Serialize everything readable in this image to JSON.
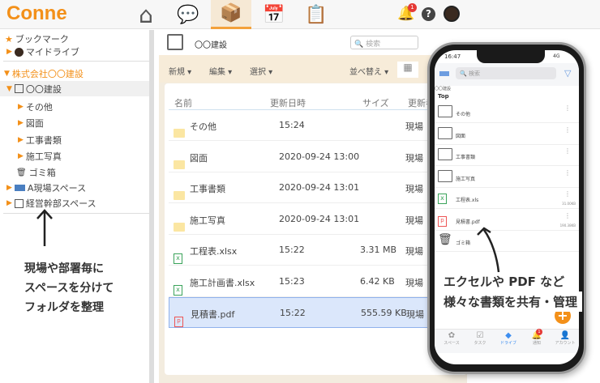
{
  "header": {
    "logo": "Conne",
    "nav": [
      {
        "icon": "home-icon",
        "glyph": "⌂"
      },
      {
        "icon": "chat-icon",
        "glyph": "💬"
      },
      {
        "icon": "drive-box-icon",
        "glyph": "📦",
        "active": true
      },
      {
        "icon": "calendar-icon",
        "glyph": "📅"
      },
      {
        "icon": "document-icon",
        "glyph": "📋"
      }
    ],
    "notification_count": "1",
    "help": "?"
  },
  "sidebar": {
    "bookmark": "ブックマーク",
    "my_drive": "マイドライブ",
    "company": "株式会社〇〇建設",
    "space": "〇〇建設",
    "folders": [
      "その他",
      "図面",
      "工事書類",
      "施工写真"
    ],
    "trash": "ゴミ箱",
    "spaces": [
      "A現場スペース",
      "経営幹部スペース"
    ]
  },
  "main": {
    "title": "〇〇建設",
    "search_placeholder": "検索",
    "toolbar": {
      "new": "新規",
      "edit": "編集",
      "select": "選択",
      "sort": "並べ替え"
    },
    "columns": [
      "名前",
      "更新日時",
      "サイズ",
      "更新者"
    ],
    "rows": [
      {
        "name": "その他",
        "type": "folder",
        "date": "15:24",
        "size": "",
        "user": "現場"
      },
      {
        "name": "図面",
        "type": "folder",
        "date": "2020-09-24 13:00",
        "size": "",
        "user": "現場"
      },
      {
        "name": "工事書類",
        "type": "folder",
        "date": "2020-09-24 13:01",
        "size": "",
        "user": "現場"
      },
      {
        "name": "施工写真",
        "type": "folder",
        "date": "2020-09-24 13:01",
        "size": "",
        "user": "現場"
      },
      {
        "name": "工程表.xlsx",
        "type": "excel",
        "date": "15:22",
        "size": "3.31 MB",
        "user": "現場"
      },
      {
        "name": "施工計画書.xlsx",
        "type": "excel",
        "date": "15:23",
        "size": "6.42 KB",
        "user": "現場"
      },
      {
        "name": "見積書.pdf",
        "type": "pdf",
        "date": "15:22",
        "size": "555.59 KB",
        "user": "現場",
        "selected": true
      }
    ]
  },
  "phone": {
    "time": "16:47",
    "signal": "4G",
    "search_placeholder": "検索",
    "breadcrumb": "〇〇建設",
    "title": "Top",
    "items": [
      {
        "name": "その他",
        "type": "folder"
      },
      {
        "name": "図面",
        "type": "folder"
      },
      {
        "name": "工事書類",
        "type": "folder"
      },
      {
        "name": "施工写真",
        "type": "folder"
      },
      {
        "name": "工程表.xls",
        "type": "excel",
        "size": "31.00KB"
      },
      {
        "name": "見積書.pdf",
        "type": "pdf",
        "size": "190.38KB"
      },
      {
        "name": "ゴミ箱",
        "type": "trash"
      }
    ],
    "tabs": [
      "スペース",
      "タスク",
      "ドライブ",
      "通知",
      "アカウント"
    ],
    "notif_count": "1",
    "accent": "#3d8ef0"
  },
  "annotations": {
    "left": [
      "現場や部署毎に",
      "スペースを分けて",
      "フォルダを整理"
    ],
    "right": [
      "エクセルや PDF など",
      "様々な書類を共有・管理"
    ]
  },
  "colors": {
    "brand": "#f39019",
    "toolbar": "#f7ecd9",
    "selected": "#dbe7fb"
  }
}
